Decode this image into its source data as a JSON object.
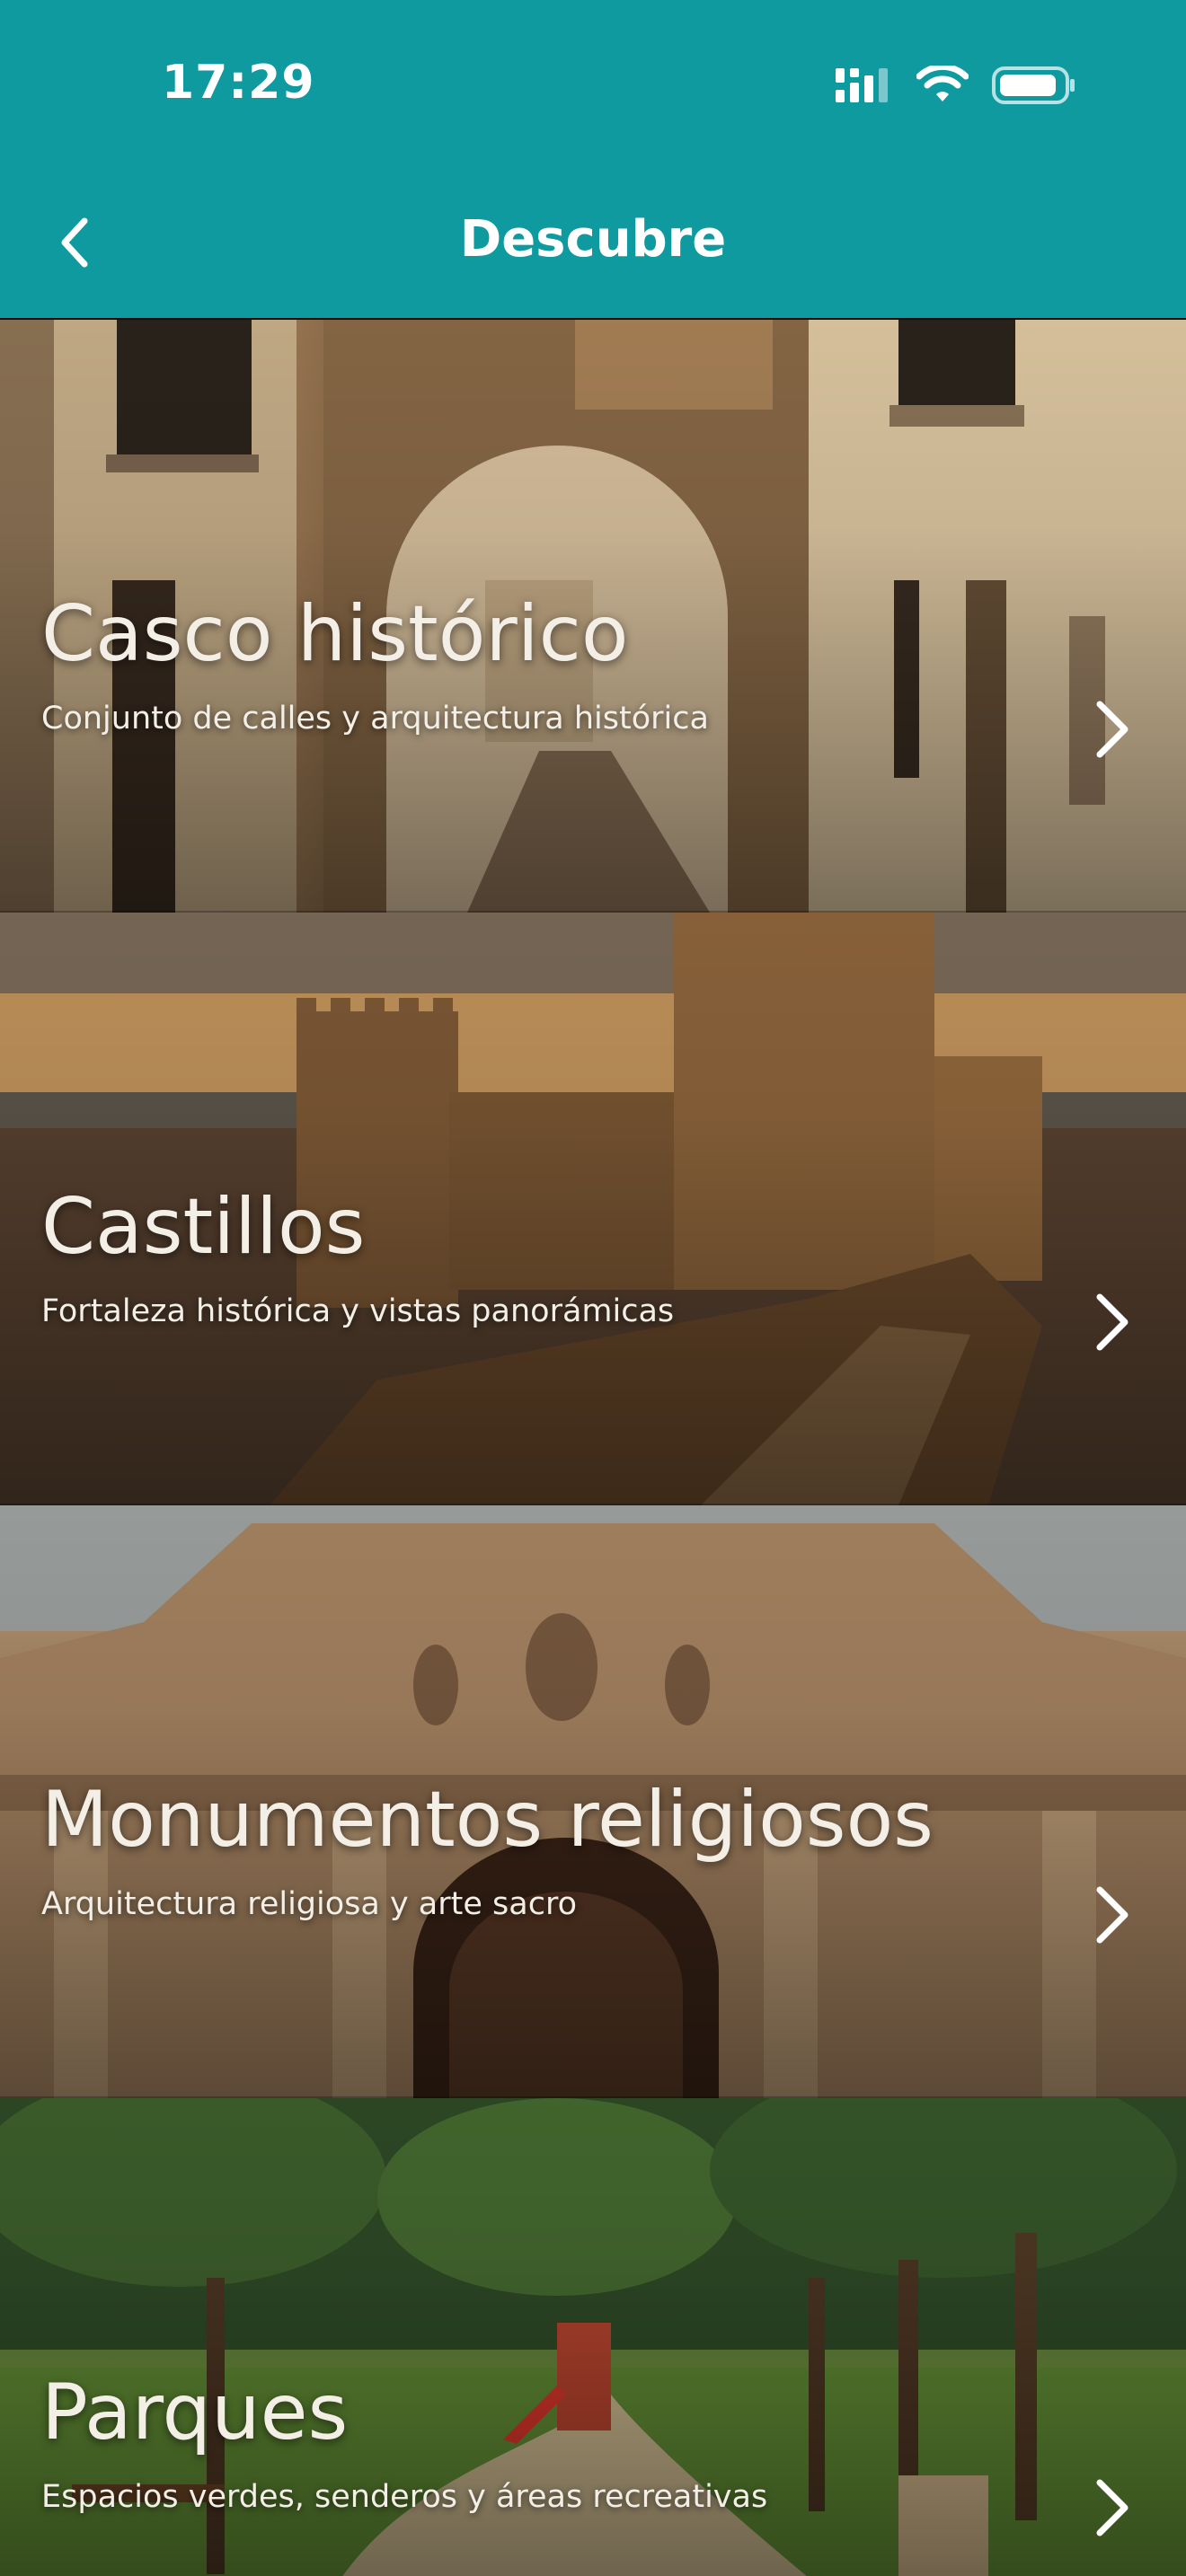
{
  "status_bar": {
    "time": "17:29"
  },
  "header": {
    "title": "Descubre",
    "back_icon": "chevron-left-icon"
  },
  "theme": {
    "header_color": "#0f9aa0",
    "text_on_image": "#f4efe6"
  },
  "categories": [
    {
      "title": "Casco histórico",
      "subtitle": "Conjunto de calles y arquitectura histórica",
      "image": "historic-quarter-street-with-stone-arch"
    },
    {
      "title": "Castillos",
      "subtitle": "Fortaleza histórica y vistas panorámicas",
      "image": "castle-walls-at-sunset"
    },
    {
      "title": "Monumentos religiosos",
      "subtitle": "Arquitectura religiosa y arte sacro",
      "image": "baroque-church-facade-with-statues"
    },
    {
      "title": "Parques",
      "subtitle": "Espacios verdes, senderos y áreas recreativas",
      "image": "park-with-trees-paths-and-playground"
    }
  ]
}
